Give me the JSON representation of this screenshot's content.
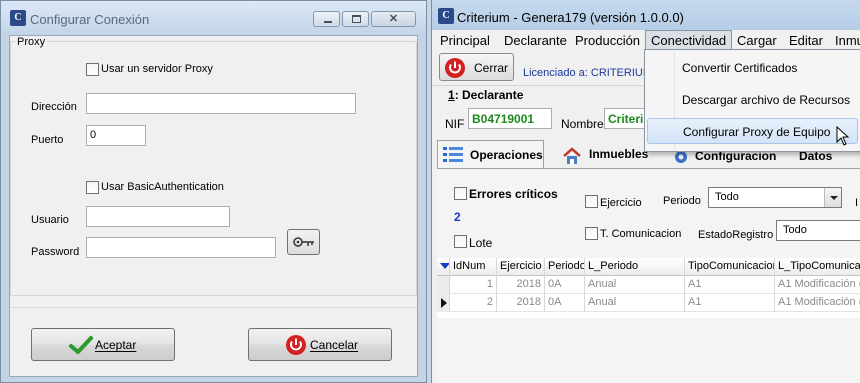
{
  "dialog": {
    "title": "Configurar Conexión",
    "group_label": "Proxy",
    "use_proxy_label": "Usar un servidor Proxy",
    "address_label": "Dirección",
    "address_value": "",
    "port_label": "Puerto",
    "port_value": "0",
    "basic_auth_label": "Usar BasicAuthentication",
    "user_label": "Usuario",
    "user_value": "",
    "password_label": "Password",
    "password_value": "",
    "accept_label": "Aceptar",
    "cancel_label": "Cancelar"
  },
  "main": {
    "title": "Criterium - Genera179 (versión 1.0.0.0)",
    "menu": [
      "Principal",
      "Declarante",
      "Producción",
      "Conectividad",
      "Cargar",
      "Editar",
      "Inmu"
    ],
    "toolbar": {
      "close_label": "Cerrar",
      "license_text": "Licenciado a: CRITERIUM"
    },
    "section": {
      "number": "1",
      "title": ": Declarante"
    },
    "nif_label": "NIF",
    "nif_value": "B04719001",
    "nombre_label": "Nombre",
    "nombre_value": "Criteri",
    "tabs": [
      "Operaciones",
      "Inmuebles",
      "Configuracion",
      "Datos"
    ],
    "filters": {
      "errores_label": "Errores críticos",
      "errores_count": "2",
      "lote_label": "Lote",
      "ejercicio_label": "Ejercicio",
      "periodo_label": "Periodo",
      "periodo_value": "Todo",
      "tcom_label": "T. Comunicacion",
      "estado_label": "EstadoRegistro",
      "estado_value": "Todo",
      "cut_label": "I"
    },
    "grid": {
      "columns": [
        "IdNum",
        "Ejercicio",
        "Periodo",
        "L_Periodo",
        "TipoComunicacion",
        "L_TipoComunicaci"
      ],
      "rows": [
        [
          "1",
          "2018",
          "0A",
          "Anual",
          "A1",
          "A1 Modificación ("
        ],
        [
          "2",
          "2018",
          "0A",
          "Anual",
          "A1",
          "A1 Modificación ("
        ]
      ]
    }
  },
  "dropdown_menu": {
    "items": [
      "Convertir Certificados",
      "Descargar archivo de Recursos",
      "Configurar Proxy de Equipo"
    ]
  },
  "colors": {
    "license": "#1a3a9a",
    "nif_value": "#1b8a1b",
    "count": "#1a3ac8",
    "menu_highlight": "#d3e4f7"
  }
}
